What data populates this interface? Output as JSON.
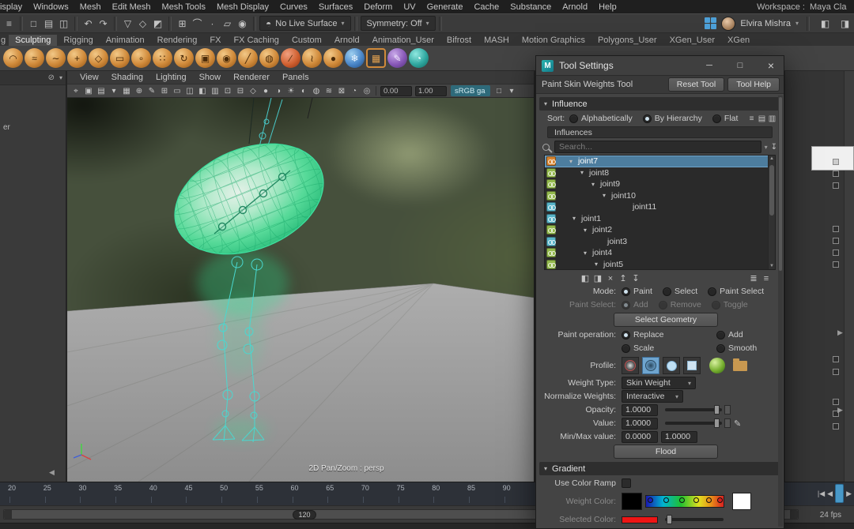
{
  "icons": {
    "menu": "≡",
    "new_scene": "□",
    "open_scene": "▤",
    "save_scene": "◫",
    "undo": "↶",
    "redo": "↷",
    "select_hierarchy": "▽",
    "select_object": "◇",
    "select_component": "◩",
    "snap_grid": "⊞",
    "snap_curve": "⌒",
    "snap_point": "∙",
    "snap_plane": "▱",
    "make_live": "◉",
    "live_surface": "◓",
    "caret_down": "▾",
    "caret_right": "▸",
    "panel_left": "◧",
    "panel_right": "◨",
    "minimize": "─",
    "maximize": "□",
    "close": "×",
    "hide": "⊘",
    "collapse": "◀",
    "pencil": "✎",
    "filter": "↧",
    "step_back": "|◀",
    "play_back": "◀",
    "play_fwd": "▶",
    "step_fwd": "▶|"
  },
  "menubar": {
    "items": [
      "Display",
      "Windows",
      "Mesh",
      "Edit Mesh",
      "Mesh Tools",
      "Mesh Display",
      "Curves",
      "Surfaces",
      "Deform",
      "UV",
      "Generate",
      "Cache",
      "Substance",
      "Arnold",
      "Help"
    ],
    "workspace_label": "Workspace :",
    "workspace_value": "Maya Cla"
  },
  "statusbar": {
    "no_live_surface": "No Live Surface",
    "symmetry": "Symmetry: Off",
    "user_name": "Elvira Mishra"
  },
  "shelf": {
    "left_partial": "g",
    "tabs": [
      {
        "label": "Sculpting",
        "cls": "active"
      },
      {
        "label": "Rigging"
      },
      {
        "label": "Animation"
      },
      {
        "label": "Rendering"
      },
      {
        "label": "FX"
      },
      {
        "label": "FX Caching"
      },
      {
        "label": "Custom"
      },
      {
        "label": "Arnold"
      },
      {
        "label": "Animation_User"
      },
      {
        "label": "Bifrost"
      },
      {
        "label": "MASH"
      },
      {
        "label": "Motion Graphics"
      },
      {
        "label": "Polygons_User"
      },
      {
        "label": "XGen_User"
      },
      {
        "label": "XGen"
      }
    ],
    "brushes": [
      {
        "name": "lift-brush",
        "glyph": "◠",
        "cls": "c-or"
      },
      {
        "name": "sculpt-smooth-brush",
        "glyph": "≈",
        "cls": "c-or"
      },
      {
        "name": "relax-brush",
        "glyph": "∼",
        "cls": "c-or"
      },
      {
        "name": "grab-brush",
        "glyph": "+",
        "cls": "c-or"
      },
      {
        "name": "pinch-brush",
        "glyph": "◇",
        "cls": "c-or"
      },
      {
        "name": "flatten-brush",
        "glyph": "▭",
        "cls": "c-or"
      },
      {
        "name": "foamy-brush",
        "glyph": "∘",
        "cls": "c-or"
      },
      {
        "name": "spray-brush",
        "glyph": "∷",
        "cls": "c-or"
      },
      {
        "name": "repeat-brush",
        "glyph": "↻",
        "cls": "c-or"
      },
      {
        "name": "imprint-brush",
        "glyph": "▣",
        "cls": "c-or"
      },
      {
        "name": "wax-brush",
        "glyph": "◉",
        "cls": "c-or"
      },
      {
        "name": "scrape-brush",
        "glyph": "╱",
        "cls": "c-or"
      },
      {
        "name": "fill-brush",
        "glyph": "◍",
        "cls": "c-or"
      },
      {
        "name": "knife-brush",
        "glyph": "∕",
        "cls": "c-red"
      },
      {
        "name": "smear-brush",
        "glyph": "≀",
        "cls": "c-or"
      },
      {
        "name": "bulge-brush",
        "glyph": "●",
        "cls": "c-or"
      },
      {
        "name": "freeze-brush",
        "glyph": "❄",
        "cls": "c-blue"
      },
      {
        "name": "freeze-select-brush",
        "glyph": "▦",
        "cls": "c-frame"
      },
      {
        "name": "sculpt-paint-brush",
        "glyph": "✎",
        "cls": "c-pur"
      },
      {
        "name": "clone-target-brush",
        "glyph": "◔",
        "cls": "c-teal"
      }
    ]
  },
  "left_panel": {
    "partial_text": "er"
  },
  "viewport": {
    "menus": [
      "View",
      "Shading",
      "Lighting",
      "Show",
      "Renderer",
      "Panels"
    ],
    "toolbar_icons": [
      {
        "name": "select-camera-icon",
        "glyph": "⌖"
      },
      {
        "name": "lock-camera-icon",
        "glyph": "▣"
      },
      {
        "name": "camera-attributes-icon",
        "glyph": "▤"
      },
      {
        "name": "bookmarks-icon",
        "glyph": "▾"
      },
      {
        "name": "image-plane-icon",
        "glyph": "▦"
      },
      {
        "name": "2d-pan-zoom-icon",
        "glyph": "⊕"
      },
      {
        "name": "grease-pencil-icon",
        "glyph": "✎"
      },
      {
        "name": "grid-icon",
        "glyph": "⊞"
      },
      {
        "name": "film-gate-icon",
        "glyph": "▭"
      },
      {
        "name": "resolution-gate-icon",
        "glyph": "◫"
      },
      {
        "name": "gate-mask-icon",
        "glyph": "◧"
      },
      {
        "name": "field-chart-icon",
        "glyph": "▥"
      },
      {
        "name": "safe-action-icon",
        "glyph": "⊡"
      },
      {
        "name": "safe-title-icon",
        "glyph": "⊟"
      },
      {
        "name": "wireframe-icon",
        "glyph": "◇"
      },
      {
        "name": "smooth-shade-icon",
        "glyph": "●"
      },
      {
        "name": "textured-icon",
        "glyph": "◑"
      },
      {
        "name": "use-all-lights-icon",
        "glyph": "☀"
      },
      {
        "name": "shadows-icon",
        "glyph": "◐"
      },
      {
        "name": "ambient-occlusion-icon",
        "glyph": "◍"
      },
      {
        "name": "motion-blur-icon",
        "glyph": "≋"
      },
      {
        "name": "multisample-icon",
        "glyph": "⊠"
      },
      {
        "name": "xray-icon",
        "glyph": "◔"
      },
      {
        "name": "isolate-select-icon",
        "glyph": "◎"
      }
    ],
    "exposure": "0.00",
    "gamma": "1.00",
    "colorspace": "sRGB ga",
    "hud": "2D Pan/Zoom : persp"
  },
  "tool_settings": {
    "title": "Tool Settings",
    "tool_name": "Paint Skin Weights Tool",
    "reset": "Reset Tool",
    "help": "Tool Help",
    "influence": {
      "header": "Influence",
      "sort_label": "Sort:",
      "sort_alpha": "Alphabetically",
      "sort_hier": "By Hierarchy",
      "sort_flat": "Flat",
      "sort_icons": [
        "≡",
        "▤",
        "▥"
      ],
      "subheader": "Influences",
      "search_placeholder": "Search...",
      "joints": [
        {
          "name": "joint7",
          "color": "#d8842f"
        },
        {
          "name": "joint8",
          "color": "#93b94c"
        },
        {
          "name": "joint9",
          "color": "#93b94c"
        },
        {
          "name": "joint10",
          "color": "#93b94c"
        },
        {
          "name": "joint11",
          "color": "#58b4c8"
        },
        {
          "name": "joint1",
          "color": "#58b4c8"
        },
        {
          "name": "joint2",
          "color": "#93b94c"
        },
        {
          "name": "joint3",
          "color": "#58b4c8"
        },
        {
          "name": "joint4",
          "color": "#93b94c"
        },
        {
          "name": "joint5",
          "color": "#93b94c"
        }
      ]
    },
    "weights_icons_left": [
      "◧",
      "◨",
      "×",
      "↥",
      "↧"
    ],
    "weights_icons_right": [
      "≣",
      "≡"
    ],
    "mode_label": "Mode:",
    "mode_paint": "Paint",
    "mode_select": "Select",
    "mode_paint_select": "Paint Select",
    "paint_select_label": "Paint Select:",
    "ps_add": "Add",
    "ps_remove": "Remove",
    "ps_toggle": "Toggle",
    "select_geometry": "Select Geometry",
    "paint_op_label": "Paint operation:",
    "op_replace": "Replace",
    "op_add": "Add",
    "op_scale": "Scale",
    "op_smooth": "Smooth",
    "profile_label": "Profile:",
    "weight_type_label": "Weight Type:",
    "weight_type_value": "Skin Weight",
    "normalize_label": "Normalize Weights:",
    "normalize_value": "Interactive",
    "opacity_label": "Opacity:",
    "opacity_value": "1.0000",
    "value_label": "Value:",
    "value_value": "1.0000",
    "minmax_label": "Min/Max value:",
    "min_value": "0.0000",
    "max_value": "1.0000",
    "flood": "Flood",
    "gradient_header": "Gradient",
    "use_color_ramp": "Use Color Ramp",
    "weight_color_label": "Weight Color:",
    "selected_color_label": "Selected Color:",
    "selected_color": "#ee1515",
    "ramp_stops": [
      {
        "color": "#2020b8"
      },
      {
        "color": "#00b4d0"
      },
      {
        "color": "#28c030"
      },
      {
        "color": "#e0e020"
      },
      {
        "color": "#e89018"
      },
      {
        "color": "#d82020"
      }
    ]
  },
  "timeline": {
    "ticks": [
      "20",
      "25",
      "30",
      "35",
      "40",
      "45",
      "50",
      "55",
      "60",
      "65",
      "70",
      "75",
      "80",
      "85",
      "90"
    ],
    "range_end": "120",
    "fps": "24 fps"
  }
}
